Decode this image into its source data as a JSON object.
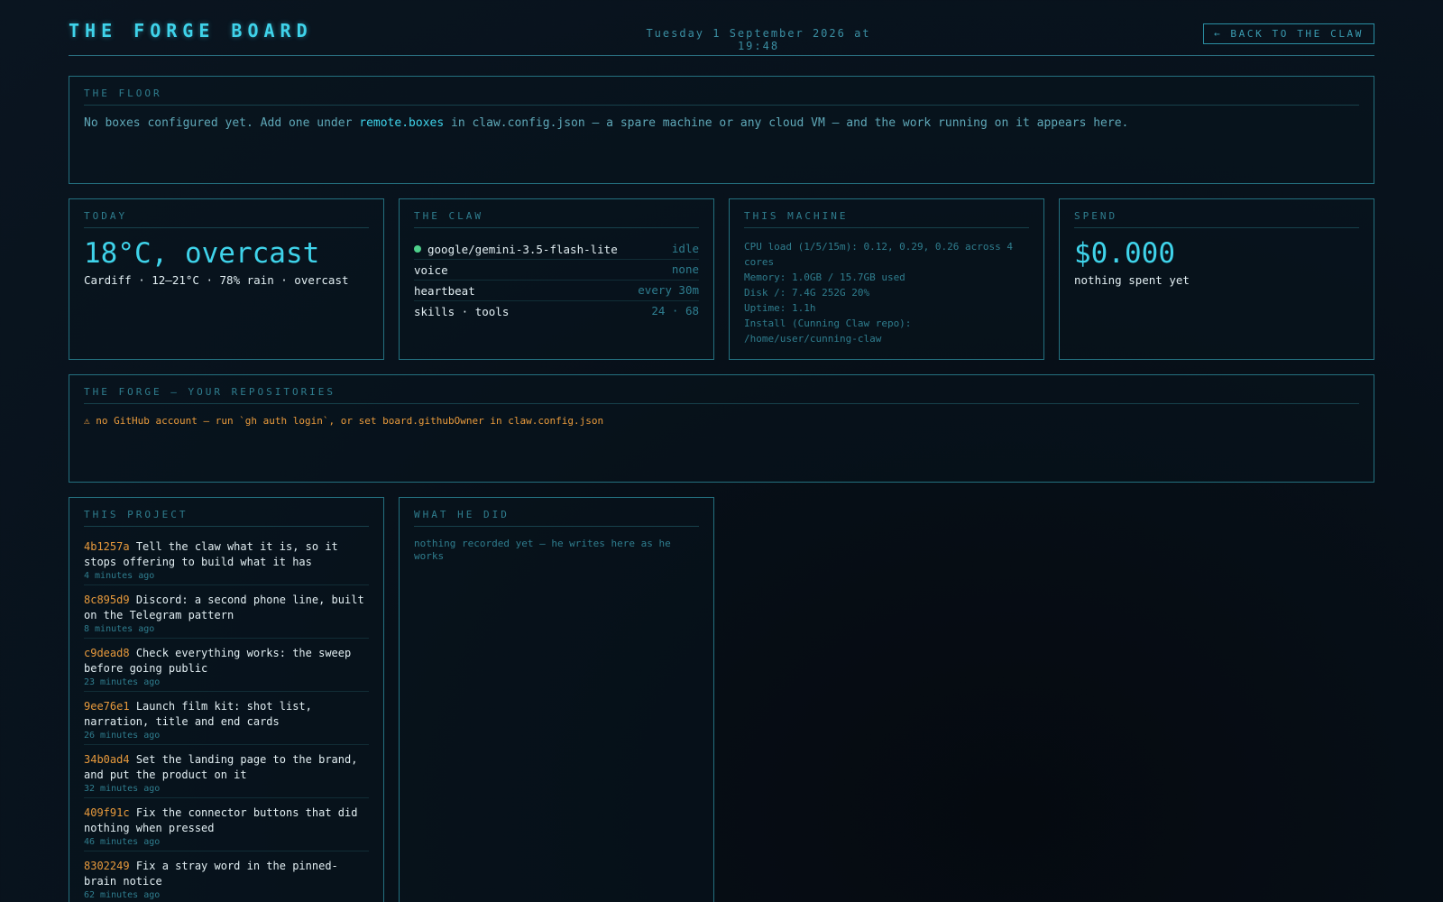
{
  "header": {
    "title": "THE FORGE BOARD",
    "datetime": "Tuesday 1 September 2026 at 19:48",
    "back_label": "← BACK TO THE CLAW"
  },
  "floor": {
    "title": "THE FLOOR",
    "text_before": "No boxes configured yet. Add one under ",
    "highlight": "remote.boxes",
    "text_after": " in claw.config.json — a spare machine or any cloud VM — and the work running on it appears here."
  },
  "today": {
    "title": "TODAY",
    "headline": "18°C, overcast",
    "detail": "Cardiff · 12–21°C · 78% rain · overcast"
  },
  "claw": {
    "title": "THE CLAW",
    "rows": [
      {
        "key": "google/gemini-3.5-flash-lite",
        "value": "idle"
      },
      {
        "key": "voice",
        "value": "none"
      },
      {
        "key": "heartbeat",
        "value": "every 30m"
      },
      {
        "key": "skills · tools",
        "value": "24 · 68"
      }
    ]
  },
  "machine": {
    "title": "THIS MACHINE",
    "lines": [
      "CPU load (1/5/15m): 0.12, 0.29, 0.26 across 4 cores",
      "Memory: 1.0GB / 15.7GB used",
      "Disk /: 7.4G  252G  20%",
      "Uptime: 1.1h",
      "Install (Cunning Claw repo): /home/user/cunning-claw"
    ]
  },
  "spend": {
    "title": "SPEND",
    "amount": "$0.000",
    "note": "nothing spent yet"
  },
  "forge": {
    "title": "THE FORGE — YOUR REPOSITORIES",
    "warning": "⚠ no GitHub account — run `gh auth login`, or set board.githubOwner in claw.config.json"
  },
  "project": {
    "title": "THIS PROJECT",
    "commits": [
      {
        "hash": "4b1257a",
        "message": "Tell the claw what it is, so it stops offering to build what it has",
        "ago": "4 minutes ago"
      },
      {
        "hash": "8c895d9",
        "message": "Discord: a second phone line, built on the Telegram pattern",
        "ago": "8 minutes ago"
      },
      {
        "hash": "c9dead8",
        "message": "Check everything works: the sweep before going public",
        "ago": "23 minutes ago"
      },
      {
        "hash": "9ee76e1",
        "message": "Launch film kit: shot list, narration, title and end cards",
        "ago": "26 minutes ago"
      },
      {
        "hash": "34b0ad4",
        "message": "Set the landing page to the brand, and put the product on it",
        "ago": "32 minutes ago"
      },
      {
        "hash": "409f91c",
        "message": "Fix the connector buttons that did nothing when pressed",
        "ago": "46 minutes ago"
      },
      {
        "hash": "8302249",
        "message": "Fix a stray word in the pinned-brain notice",
        "ago": "62 minutes ago"
      }
    ]
  },
  "did": {
    "title": "WHAT HE DID",
    "text": "nothing recorded yet — he writes here as he works"
  }
}
